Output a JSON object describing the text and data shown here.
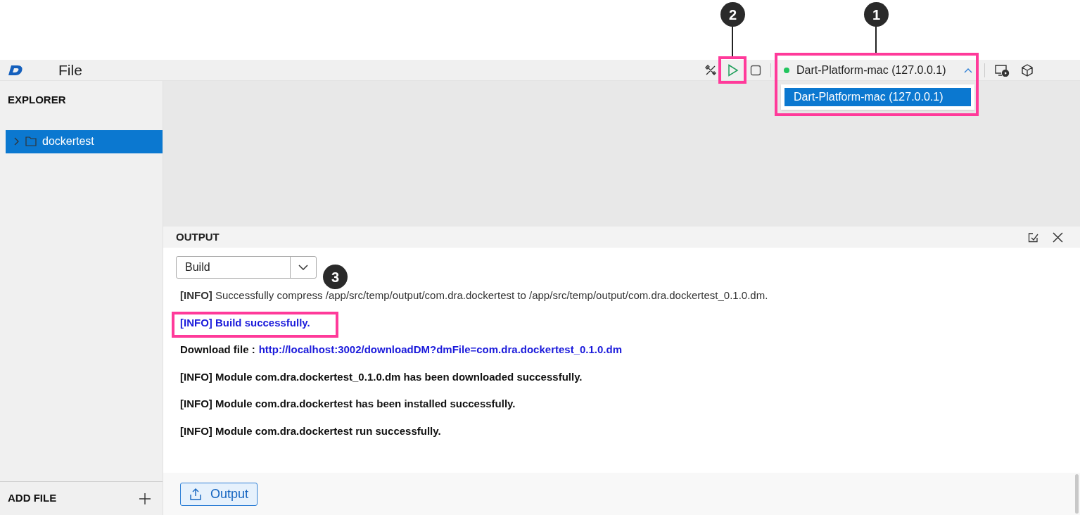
{
  "menu_bar": {
    "menu": "File"
  },
  "toolbar": {
    "device_selector": {
      "label": "Dart-Platform-mac (127.0.0.1)",
      "connected": true,
      "expanded": true
    },
    "device_options": [
      {
        "label": "Dart-Platform-mac (127.0.0.1)",
        "selected": true
      }
    ]
  },
  "sidebar": {
    "title": "EXPLORER",
    "tree": [
      {
        "label": "dockertest",
        "selected": true,
        "expanded": false
      }
    ],
    "footer": "ADD FILE"
  },
  "output_panel": {
    "title": "OUTPUT",
    "channel": "Build",
    "lines": [
      {
        "kind": "info",
        "text": "**[INFO]** Successfully compress /app/src/temp/output/com.dra.dockertest to /app/src/temp/output/com.dra.dockertest_0.1.0.dm."
      },
      {
        "kind": "success",
        "text": "[INFO] Build successfully."
      },
      {
        "kind": "download",
        "text": "Download file :",
        "link": "http://localhost:3002/downloadDM?dmFile=com.dra.dockertest_0.1.0.dm"
      },
      {
        "kind": "bold",
        "text": "[INFO] Module com.dra.dockertest_0.1.0.dm has been downloaded successfully."
      },
      {
        "kind": "bold",
        "text": "[INFO] Module com.dra.dockertest has been installed successfully."
      },
      {
        "kind": "bold",
        "text": "[INFO] Module com.dra.dockertest run successfully."
      }
    ],
    "export_button": "Output"
  },
  "annotations": {
    "device": {
      "label": "1"
    },
    "run": {
      "label": "2"
    },
    "log": {
      "label": "3"
    }
  }
}
